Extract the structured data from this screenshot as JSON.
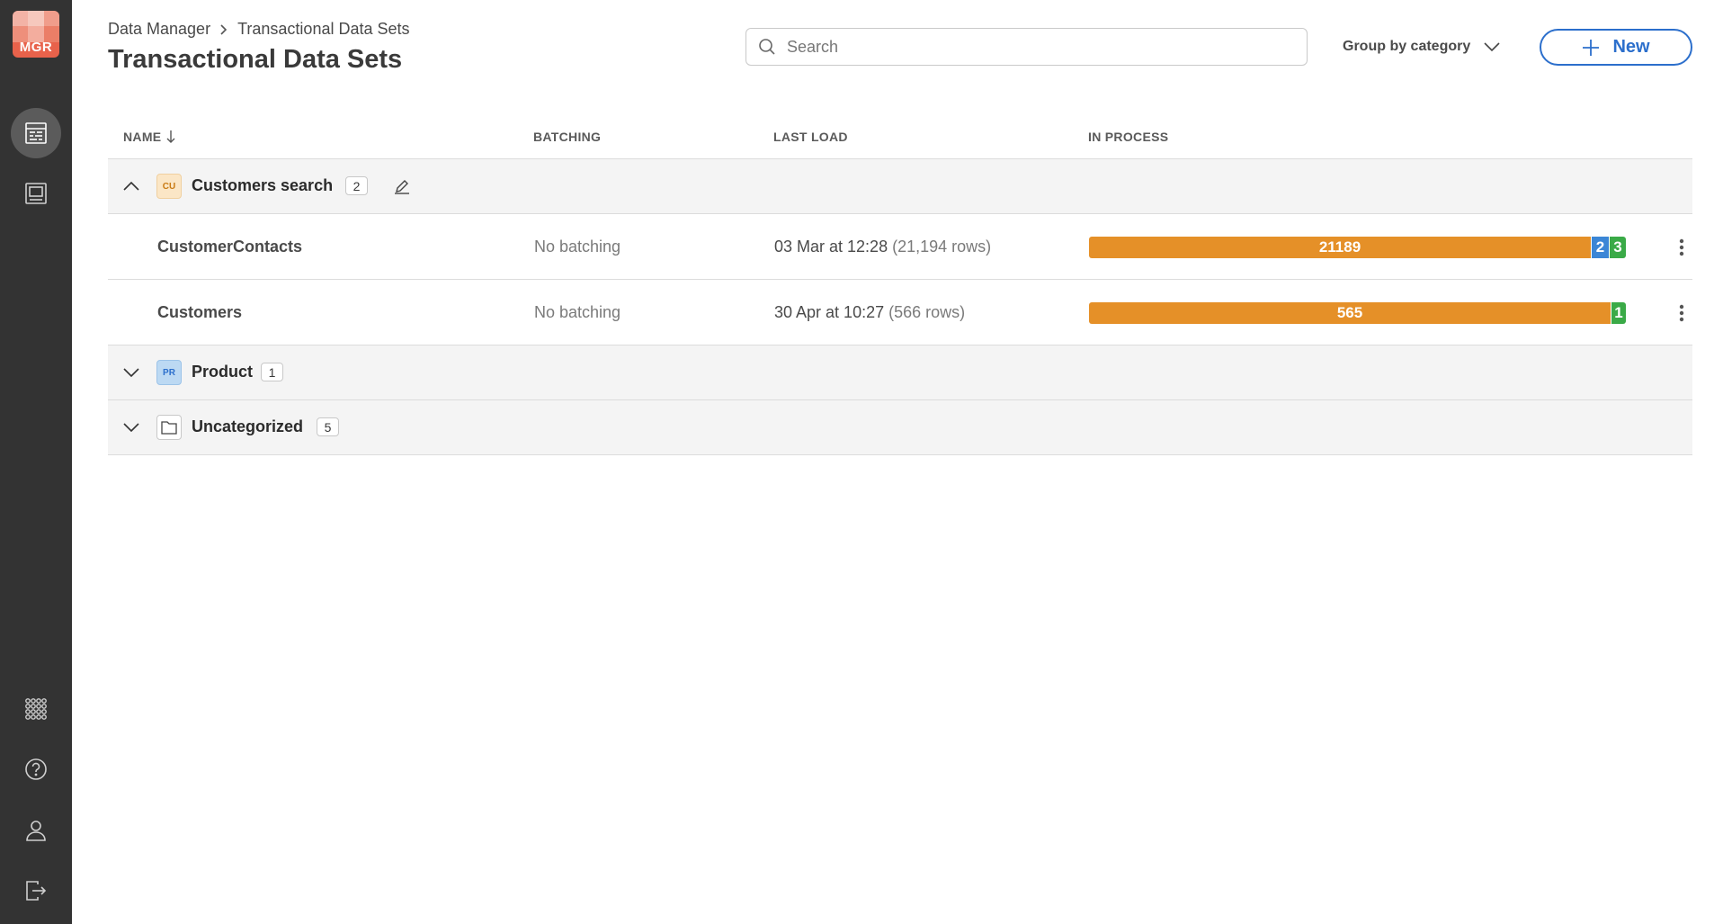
{
  "logo": {
    "text": "MGR"
  },
  "breadcrumb": {
    "parent": "Data Manager",
    "current": "Transactional Data Sets"
  },
  "page": {
    "title": "Transactional Data Sets"
  },
  "search": {
    "placeholder": "Search",
    "value": ""
  },
  "group_by": {
    "label": "Group by category"
  },
  "new_button": {
    "label": "New"
  },
  "table": {
    "headers": {
      "name": "NAME",
      "batching": "BATCHING",
      "last_load": "LAST LOAD",
      "in_process": "IN PROCESS"
    },
    "groups": [
      {
        "name": "Customers search",
        "abbr": "CU",
        "count": "2",
        "expanded": true,
        "rows": [
          {
            "name": "CustomerContacts",
            "batching": "No batching",
            "last_load": "03 Mar at 12:28",
            "rows_text": "(21,194 rows)",
            "segments": [
              {
                "value": "21189",
                "color": "orange"
              },
              {
                "value": "2",
                "color": "blue"
              },
              {
                "value": "3",
                "color": "green"
              }
            ]
          },
          {
            "name": "Customers",
            "batching": "No batching",
            "last_load": "30 Apr at 10:27",
            "rows_text": "(566 rows)",
            "segments": [
              {
                "value": "565",
                "color": "orange"
              },
              {
                "value": "1",
                "color": "green"
              }
            ]
          }
        ]
      },
      {
        "name": "Product",
        "abbr": "PR",
        "count": "1",
        "expanded": false
      },
      {
        "name": "Uncategorized",
        "count": "5",
        "expanded": false
      }
    ]
  },
  "colors": {
    "accent": "#2c6fcc",
    "orange": "#e59028",
    "blue": "#3b86d6",
    "green": "#3aaa47",
    "sidebar": "#333333"
  }
}
